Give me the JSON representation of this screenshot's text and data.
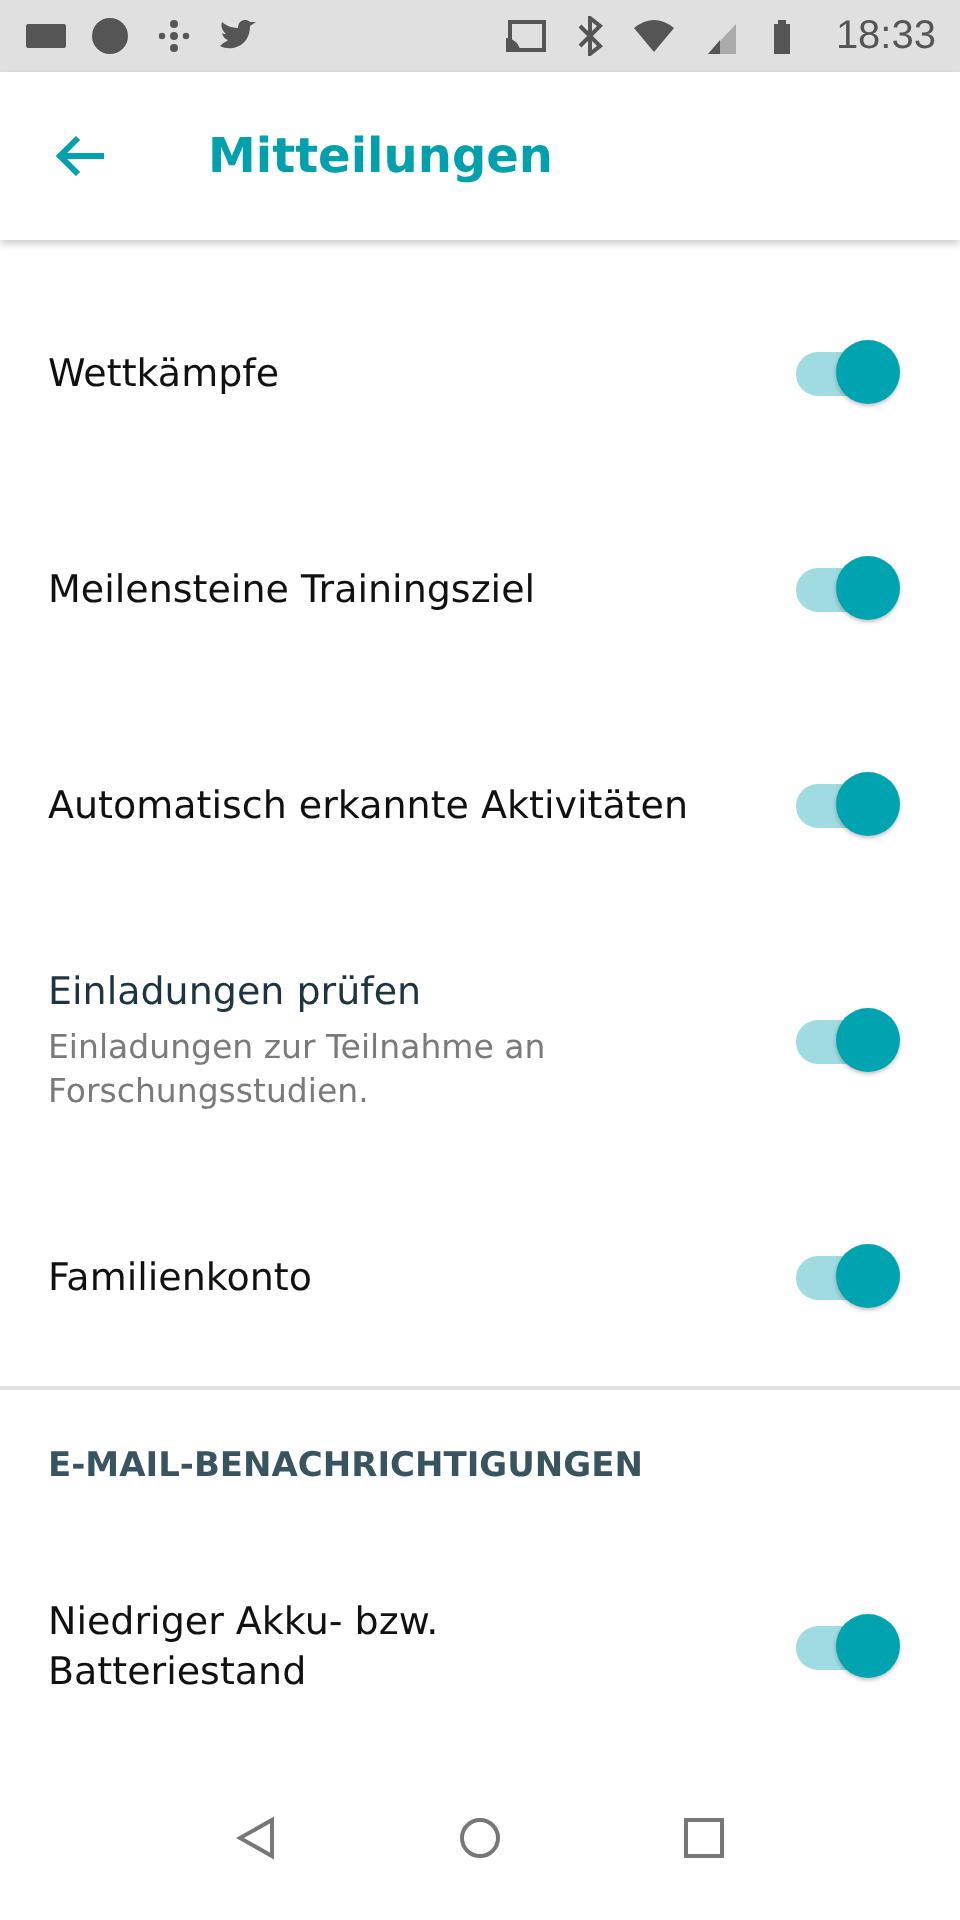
{
  "status_bar": {
    "time": "18:33"
  },
  "app_bar": {
    "title": "Mitteilungen"
  },
  "settings": [
    {
      "label": "Wettkämpfe",
      "on": true
    },
    {
      "label": "Meilensteine Trainingsziel",
      "on": true
    },
    {
      "label": "Automatisch erkannte Aktivitäten",
      "on": true
    },
    {
      "label": "Einladungen prüfen",
      "description": "Einladungen zur Teilnahme an Forschungsstudien.",
      "on": true
    },
    {
      "label": "Familienkonto",
      "on": true
    }
  ],
  "email_section": {
    "header": "E-MAIL-BENACHRICHTIGUNGEN",
    "settings": [
      {
        "label": "Niedriger Akku- bzw. Batteriestand",
        "on": true
      }
    ]
  }
}
